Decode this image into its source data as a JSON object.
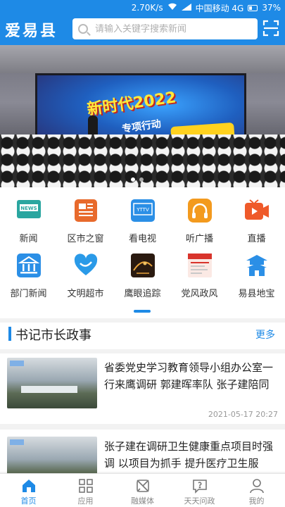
{
  "status": {
    "speed": "2.70K/s",
    "carrier": "中国移动 4G",
    "battery": "37%"
  },
  "header": {
    "brand": "爱易县",
    "search_placeholder": "请输入关键字搜索新闻"
  },
  "banner": {
    "screen_title": "新时代2022",
    "screen_sub": "专项行动"
  },
  "grid": [
    {
      "label": "新闻",
      "icon": "news-icon"
    },
    {
      "label": "区市之窗",
      "icon": "window-icon"
    },
    {
      "label": "看电视",
      "icon": "tv-icon"
    },
    {
      "label": "听广播",
      "icon": "headphones-icon"
    },
    {
      "label": "直播",
      "icon": "live-icon"
    },
    {
      "label": "部门新闻",
      "icon": "bank-icon"
    },
    {
      "label": "文明超市",
      "icon": "heart-icon"
    },
    {
      "label": "鹰眼追踪",
      "icon": "eagle-eye-icon"
    },
    {
      "label": "党风政风",
      "icon": "party-icon"
    },
    {
      "label": "易县地宝",
      "icon": "pagoda-icon"
    }
  ],
  "section": {
    "title": "书记市长政事",
    "more": "更多",
    "items": [
      {
        "title": "省委党史学习教育领导小组办公室一行来鹰调研  郭建晖率队 张子建陪同",
        "time": "2021-05-17 20:27"
      },
      {
        "title": "张子建在调研卫生健康重点项目时强调  以项目为抓手 提升医疗卫生服",
        "time": ""
      }
    ]
  },
  "tabs": [
    {
      "label": "首页",
      "icon": "home-icon",
      "active": true
    },
    {
      "label": "应用",
      "icon": "apps-icon"
    },
    {
      "label": "融媒体",
      "icon": "media-icon"
    },
    {
      "label": "天天问政",
      "icon": "question-icon"
    },
    {
      "label": "我的",
      "icon": "user-icon"
    }
  ]
}
